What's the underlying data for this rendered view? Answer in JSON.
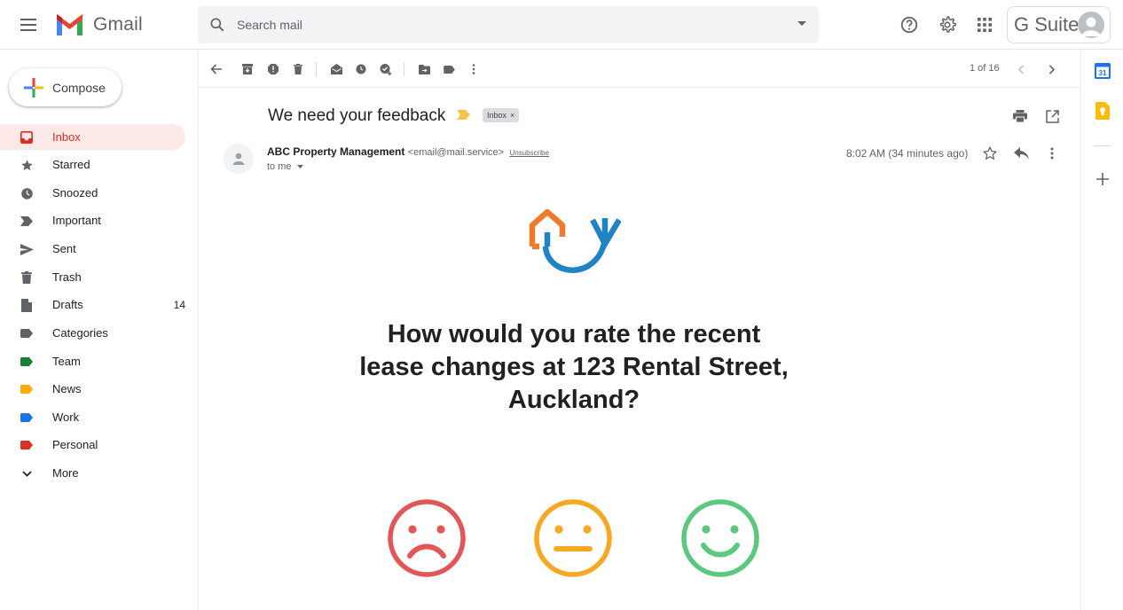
{
  "header": {
    "app_name": "Gmail",
    "search_placeholder": "Search mail",
    "account_label": "G Suite",
    "icons": [
      "menu-icon",
      "gmail-logo",
      "search-icon",
      "dropdown-icon",
      "help-icon",
      "settings-icon",
      "apps-icon",
      "avatar"
    ]
  },
  "sidebar": {
    "compose_label": "Compose",
    "items": [
      {
        "label": "Inbox",
        "icon": "inbox-icon",
        "active": true,
        "count": ""
      },
      {
        "label": "Starred",
        "icon": "star-icon",
        "count": ""
      },
      {
        "label": "Snoozed",
        "icon": "clock-icon",
        "count": ""
      },
      {
        "label": "Important",
        "icon": "important-icon",
        "count": ""
      },
      {
        "label": "Sent",
        "icon": "send-icon",
        "count": ""
      },
      {
        "label": "Trash",
        "icon": "trash-icon",
        "count": ""
      },
      {
        "label": "Drafts",
        "icon": "draft-icon",
        "count": "14"
      },
      {
        "label": "Categories",
        "icon": "label-icon",
        "color": "#5f6368",
        "count": ""
      },
      {
        "label": "Team",
        "icon": "label-icon",
        "color": "#188038",
        "count": ""
      },
      {
        "label": "News",
        "icon": "label-icon",
        "color": "#f9ab00",
        "count": ""
      },
      {
        "label": "Work",
        "icon": "label-icon",
        "color": "#1a73e8",
        "count": ""
      },
      {
        "label": "Personal",
        "icon": "label-icon",
        "color": "#d93025",
        "count": ""
      },
      {
        "label": "More",
        "icon": "chevron-down-icon",
        "count": ""
      }
    ]
  },
  "toolbar": {
    "pager": "1 of 16"
  },
  "message": {
    "subject": "We need your feedback",
    "label_chip": "Inbox",
    "label_chip_close": "×",
    "sender_name": "ABC Property Management",
    "sender_email": "<email@mail.service>",
    "unsubscribe": "Unsubscribe",
    "to": "to me",
    "time": "8:02 AM (34 minutes ago)",
    "question": "How would you rate the recent lease changes at 123 Rental Street, Auckland?",
    "ratings": [
      "sad-face",
      "neutral-face",
      "happy-face"
    ]
  },
  "addons": {
    "calendar_day": "31"
  },
  "colors": {
    "active": "#d93025",
    "active_bg": "#fce8e6",
    "sad": "#e25656",
    "neutral": "#f7a823",
    "happy": "#5ac87f",
    "logo_orange": "#f07c2b",
    "logo_blue": "#1f83c4"
  }
}
